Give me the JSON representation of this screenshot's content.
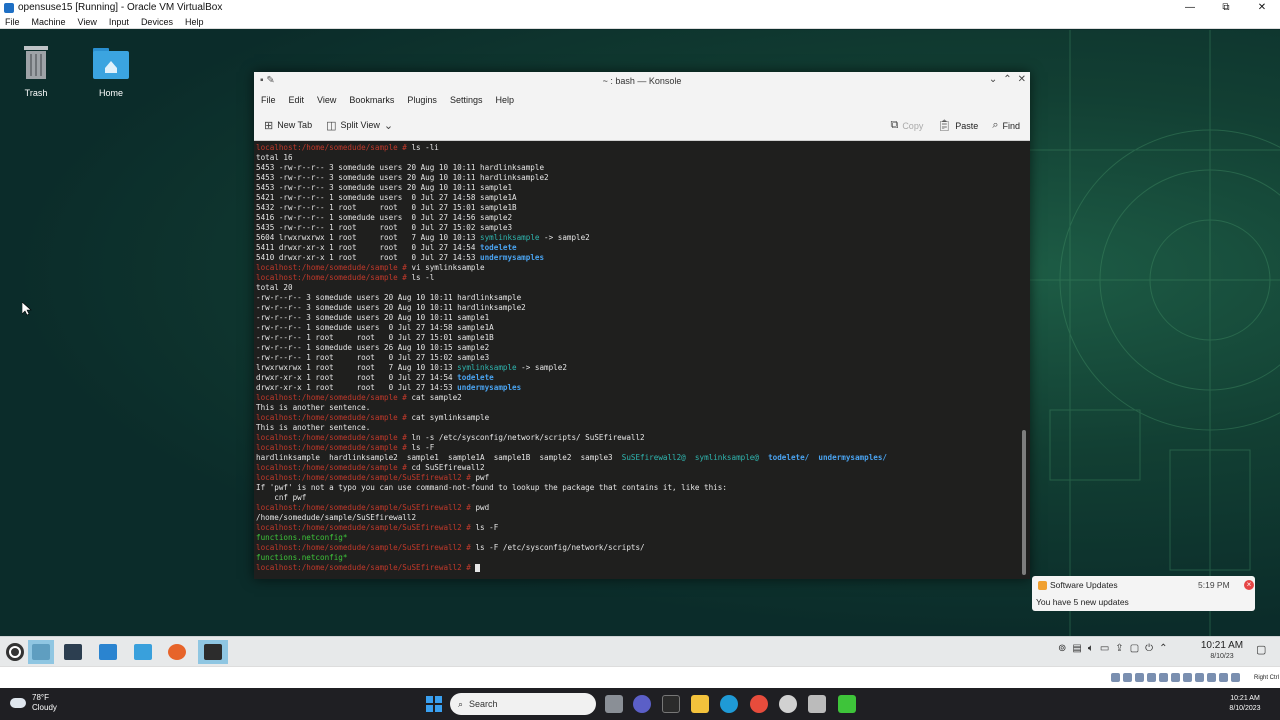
{
  "vbox": {
    "title": "opensuse15 [Running] - Oracle VM VirtualBox",
    "menu": [
      "File",
      "Machine",
      "View",
      "Input",
      "Devices",
      "Help"
    ],
    "controls": [
      "—",
      "⧉",
      "✕"
    ],
    "hostkey": "Right Ctrl"
  },
  "desktop": {
    "icons": [
      {
        "label": "Trash"
      },
      {
        "label": "Home"
      }
    ]
  },
  "konsole": {
    "title": "~ : bash — Konsole",
    "menu": [
      "File",
      "Edit",
      "View",
      "Bookmarks",
      "Plugins",
      "Settings",
      "Help"
    ],
    "toolbar": {
      "new_tab": "New Tab",
      "split_view": "Split View",
      "copy": "Copy",
      "paste": "Paste",
      "find": "Find"
    },
    "terminal_lines": [
      [
        {
          "t": "localhost:/home/somedude/sample # ",
          "c": "prompt"
        },
        {
          "t": "ls -li"
        }
      ],
      [
        {
          "t": "total 16"
        }
      ],
      [
        {
          "t": "5453 -rw-r--r-- 3 somedude users 20 Aug 10 10:11 hardlinksample"
        }
      ],
      [
        {
          "t": "5453 -rw-r--r-- 3 somedude users 20 Aug 10 10:11 hardlinksample2"
        }
      ],
      [
        {
          "t": "5453 -rw-r--r-- 3 somedude users 20 Aug 10 10:11 sample1"
        }
      ],
      [
        {
          "t": "5421 -rw-r--r-- 1 somedude users  0 Jul 27 14:58 sample1A"
        }
      ],
      [
        {
          "t": "5432 -rw-r--r-- 1 root     root   0 Jul 27 15:01 sample1B"
        }
      ],
      [
        {
          "t": "5416 -rw-r--r-- 1 somedude users  0 Jul 27 14:56 sample2"
        }
      ],
      [
        {
          "t": "5435 -rw-r--r-- 1 root     root   0 Jul 27 15:02 sample3"
        }
      ],
      [
        {
          "t": "5604 lrwxrwxrwx 1 root     root   7 Aug 10 10:13 "
        },
        {
          "t": "symlinksample",
          "c": "sym"
        },
        {
          "t": " -> sample2"
        }
      ],
      [
        {
          "t": "5411 drwxr-xr-x 1 root     root   0 Jul 27 14:54 "
        },
        {
          "t": "todelete",
          "c": "dir"
        }
      ],
      [
        {
          "t": "5410 drwxr-xr-x 1 root     root   0 Jul 27 14:53 "
        },
        {
          "t": "undermysamples",
          "c": "dir"
        }
      ],
      [
        {
          "t": "localhost:/home/somedude/sample # ",
          "c": "prompt"
        },
        {
          "t": "vi symlinksample"
        }
      ],
      [
        {
          "t": "localhost:/home/somedude/sample # ",
          "c": "prompt"
        },
        {
          "t": "ls -l"
        }
      ],
      [
        {
          "t": "total 20"
        }
      ],
      [
        {
          "t": "-rw-r--r-- 3 somedude users 20 Aug 10 10:11 hardlinksample"
        }
      ],
      [
        {
          "t": "-rw-r--r-- 3 somedude users 20 Aug 10 10:11 hardlinksample2"
        }
      ],
      [
        {
          "t": "-rw-r--r-- 3 somedude users 20 Aug 10 10:11 sample1"
        }
      ],
      [
        {
          "t": "-rw-r--r-- 1 somedude users  0 Jul 27 14:58 sample1A"
        }
      ],
      [
        {
          "t": "-rw-r--r-- 1 root     root   0 Jul 27 15:01 sample1B"
        }
      ],
      [
        {
          "t": "-rw-r--r-- 1 somedude users 26 Aug 10 10:15 sample2"
        }
      ],
      [
        {
          "t": "-rw-r--r-- 1 root     root   0 Jul 27 15:02 sample3"
        }
      ],
      [
        {
          "t": "lrwxrwxrwx 1 root     root   7 Aug 10 10:13 "
        },
        {
          "t": "symlinksample",
          "c": "sym"
        },
        {
          "t": " -> sample2"
        }
      ],
      [
        {
          "t": "drwxr-xr-x 1 root     root   0 Jul 27 14:54 "
        },
        {
          "t": "todelete",
          "c": "dir"
        }
      ],
      [
        {
          "t": "drwxr-xr-x 1 root     root   0 Jul 27 14:53 "
        },
        {
          "t": "undermysamples",
          "c": "dir"
        }
      ],
      [
        {
          "t": "localhost:/home/somedude/sample # ",
          "c": "prompt"
        },
        {
          "t": "cat sample2"
        }
      ],
      [
        {
          "t": "This is another sentence."
        }
      ],
      [
        {
          "t": "localhost:/home/somedude/sample # ",
          "c": "prompt"
        },
        {
          "t": "cat symlinksample"
        }
      ],
      [
        {
          "t": "This is another sentence."
        }
      ],
      [
        {
          "t": "localhost:/home/somedude/sample # ",
          "c": "prompt"
        },
        {
          "t": "ln -s /etc/sysconfig/network/scripts/ SuSEfirewall2"
        }
      ],
      [
        {
          "t": "localhost:/home/somedude/sample # ",
          "c": "prompt"
        },
        {
          "t": "ls -F"
        }
      ],
      [
        {
          "t": "hardlinksample  hardlinksample2  sample1  sample1A  sample1B  sample2  sample3  "
        },
        {
          "t": "SuSEfirewall2@",
          "c": "sym"
        },
        {
          "t": "  "
        },
        {
          "t": "symlinksample@",
          "c": "sym"
        },
        {
          "t": "  "
        },
        {
          "t": "todelete/",
          "c": "dir"
        },
        {
          "t": "  "
        },
        {
          "t": "undermysamples/",
          "c": "dir"
        }
      ],
      [
        {
          "t": "localhost:/home/somedude/sample # ",
          "c": "prompt"
        },
        {
          "t": "cd SuSEfirewall2"
        }
      ],
      [
        {
          "t": "localhost:/home/somedude/sample/SuSEfirewall2 # ",
          "c": "prompt"
        },
        {
          "t": "pwf"
        }
      ],
      [
        {
          "t": "If 'pwf' is not a typo you can use command-not-found to lookup the package that contains it, like this:"
        }
      ],
      [
        {
          "t": "    cnf pwf"
        }
      ],
      [
        {
          "t": "localhost:/home/somedude/sample/SuSEfirewall2 # ",
          "c": "prompt"
        },
        {
          "t": "pwd"
        }
      ],
      [
        {
          "t": "/home/somedude/sample/SuSEfirewall2"
        }
      ],
      [
        {
          "t": "localhost:/home/somedude/sample/SuSEfirewall2 # ",
          "c": "prompt"
        },
        {
          "t": "ls -F"
        }
      ],
      [
        {
          "t": "functions.netconfig*",
          "c": "exe"
        }
      ],
      [
        {
          "t": "localhost:/home/somedude/sample/SuSEfirewall2 # ",
          "c": "prompt"
        },
        {
          "t": "ls -F /etc/sysconfig/network/scripts/"
        }
      ],
      [
        {
          "t": "functions.netconfig*",
          "c": "exe"
        }
      ],
      [
        {
          "t": "localhost:/home/somedude/sample/SuSEfirewall2 # ",
          "c": "prompt"
        },
        {
          "t": "",
          "c": "cursor"
        }
      ]
    ]
  },
  "notification": {
    "title": "Software Updates",
    "time": "5:19 PM",
    "body": "You have 5 new updates"
  },
  "kde_panel": {
    "time": "10:21 AM",
    "date": "8/10/23"
  },
  "win_taskbar": {
    "weather_temp": "78°F",
    "weather_desc": "Cloudy",
    "search_placeholder": "Search",
    "time": "10:21 AM",
    "date": "8/10/2023"
  }
}
